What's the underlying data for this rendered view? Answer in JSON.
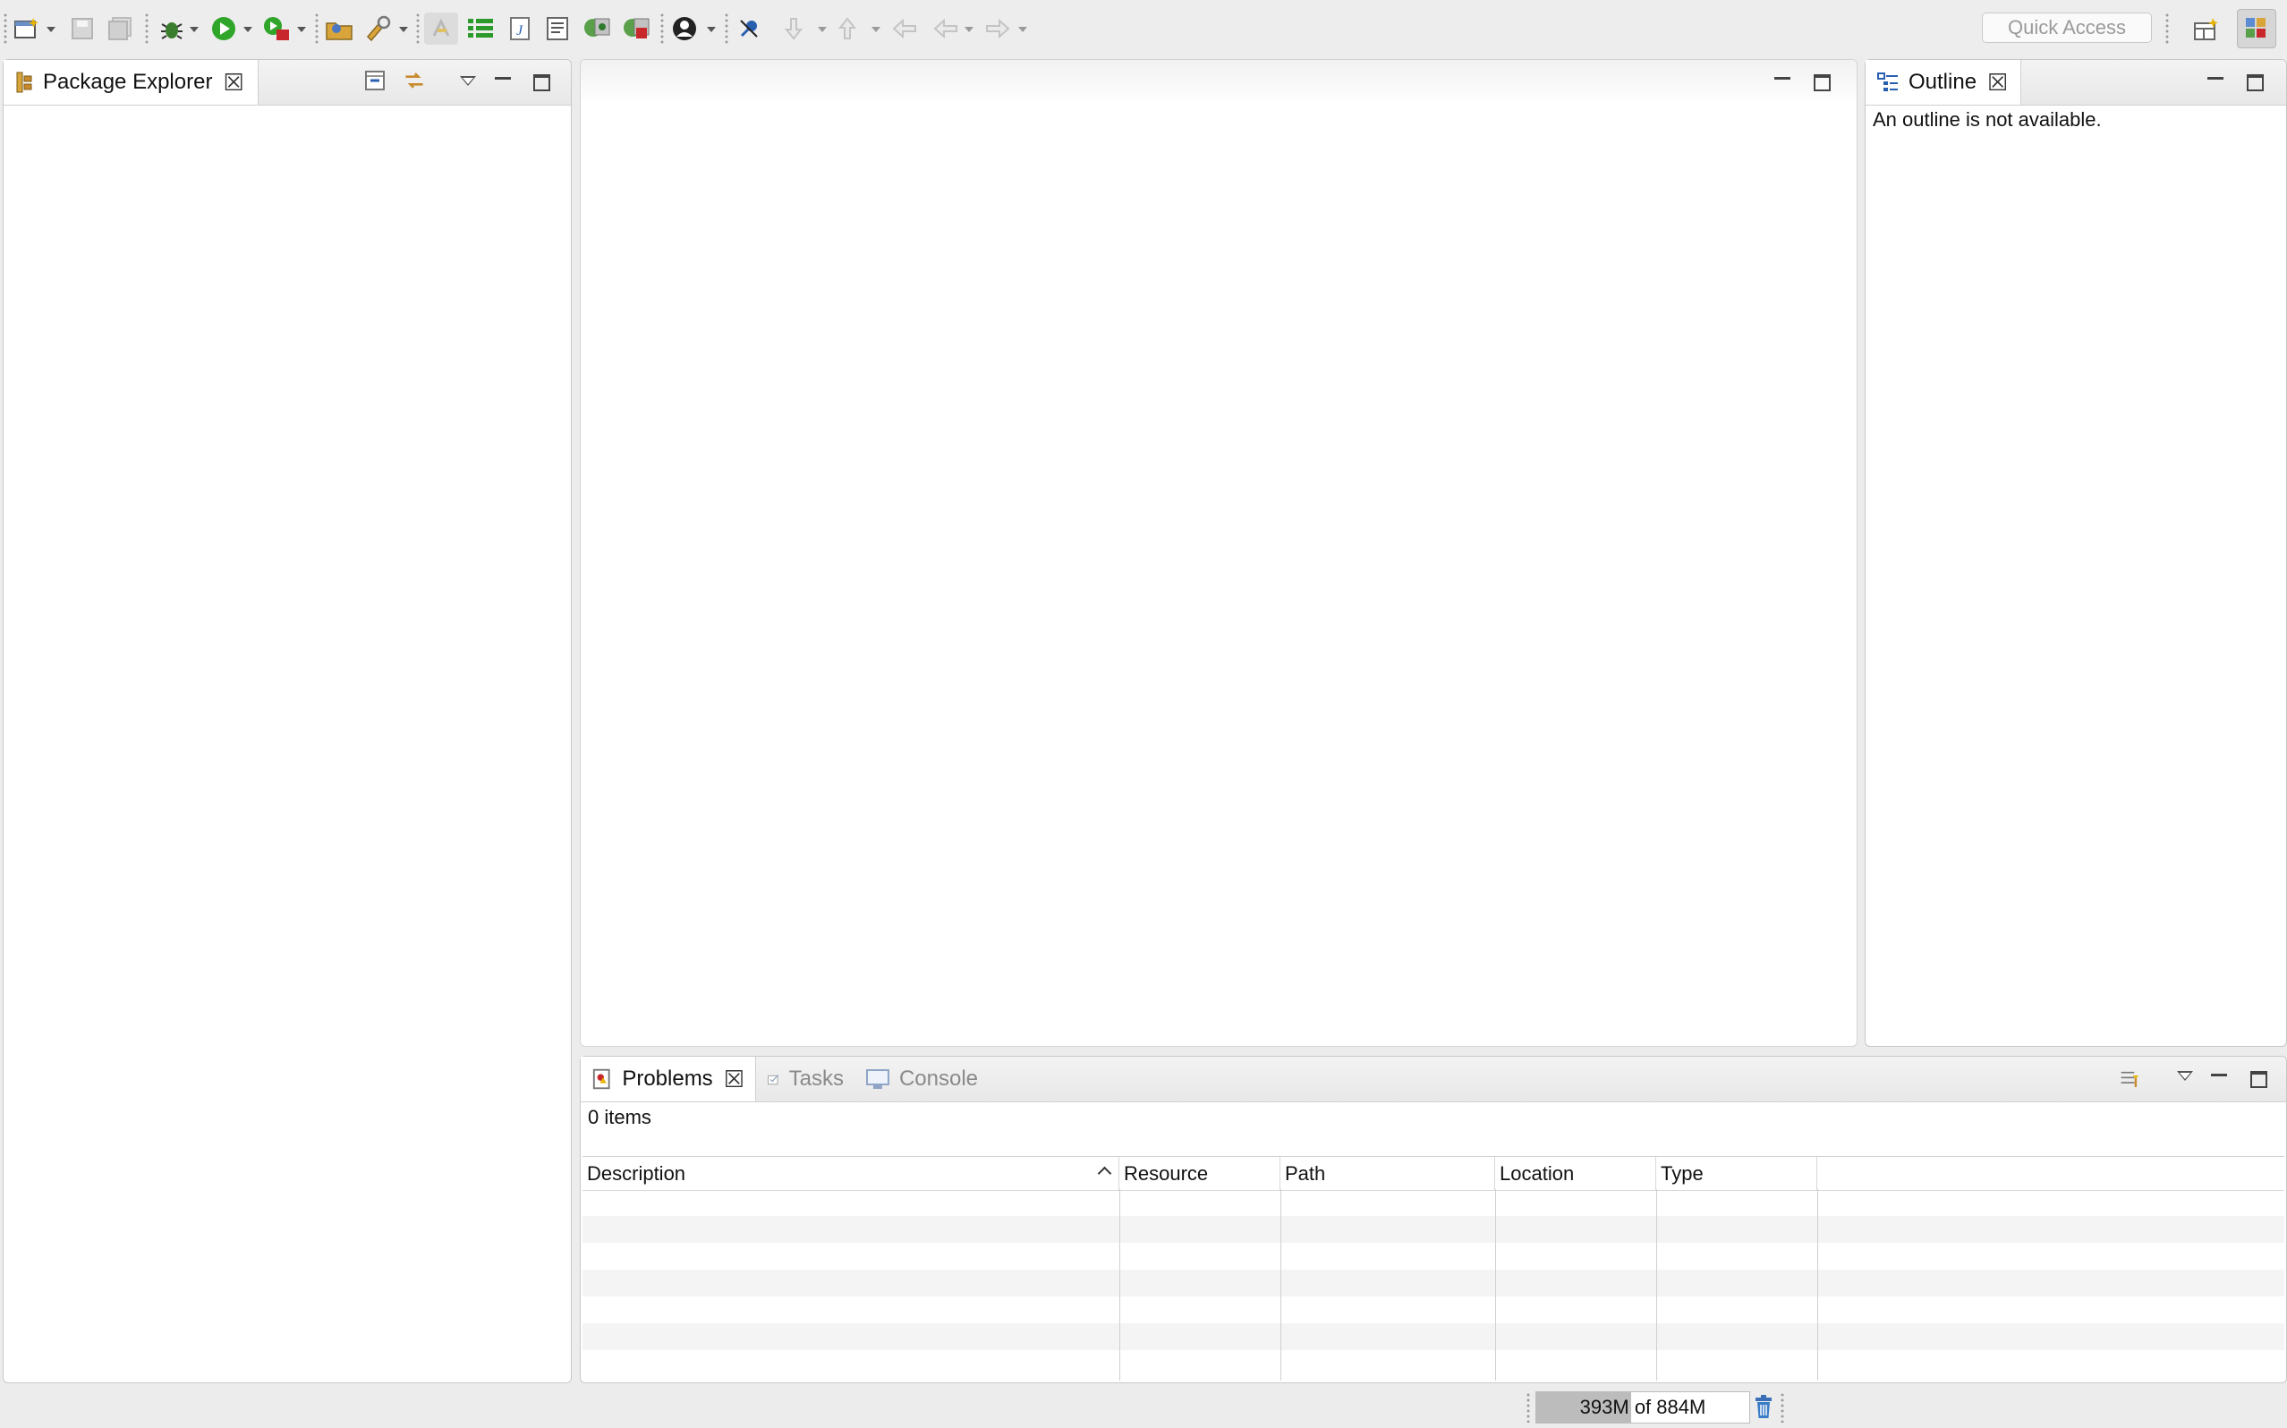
{
  "toolbar": {
    "quick_access_placeholder": "Quick Access",
    "icons": [
      "new-wizard-icon",
      "save-icon",
      "save-all-icon",
      "debug-icon",
      "run-icon",
      "run-external-tool-icon",
      "open-type-icon",
      "search-icon",
      "toggle-mark-occurrences-icon",
      "toggle-block-selection-icon",
      "toggle-word-wrap-icon",
      "show-whitespace-icon",
      "new-java-project-icon",
      "new-package-icon",
      "profile-icon",
      "pin-editor-icon",
      "next-annotation-icon",
      "previous-annotation-icon",
      "last-edit-location-icon",
      "back-icon",
      "forward-icon",
      "open-perspective-icon",
      "java-perspective-icon"
    ]
  },
  "package_explorer": {
    "tab_label": "Package Explorer"
  },
  "outline": {
    "tab_label": "Outline",
    "message": "An outline is not available."
  },
  "bottom_panel": {
    "tabs": [
      {
        "label": "Problems",
        "active": true
      },
      {
        "label": "Tasks",
        "active": false
      },
      {
        "label": "Console",
        "active": false
      }
    ],
    "item_count": "0 items",
    "columns": [
      "Description",
      "Resource",
      "Path",
      "Location",
      "Type"
    ],
    "rows": []
  },
  "status_bar": {
    "heap_used": "393M",
    "heap_total": "884M",
    "heap_text": "393M of 884M",
    "heap_fraction": 0.4446
  },
  "colors": {
    "background": "#ececec",
    "panel": "#ffffff",
    "run_green": "#2fa52a",
    "heap_bar": "#bcbcbc"
  }
}
